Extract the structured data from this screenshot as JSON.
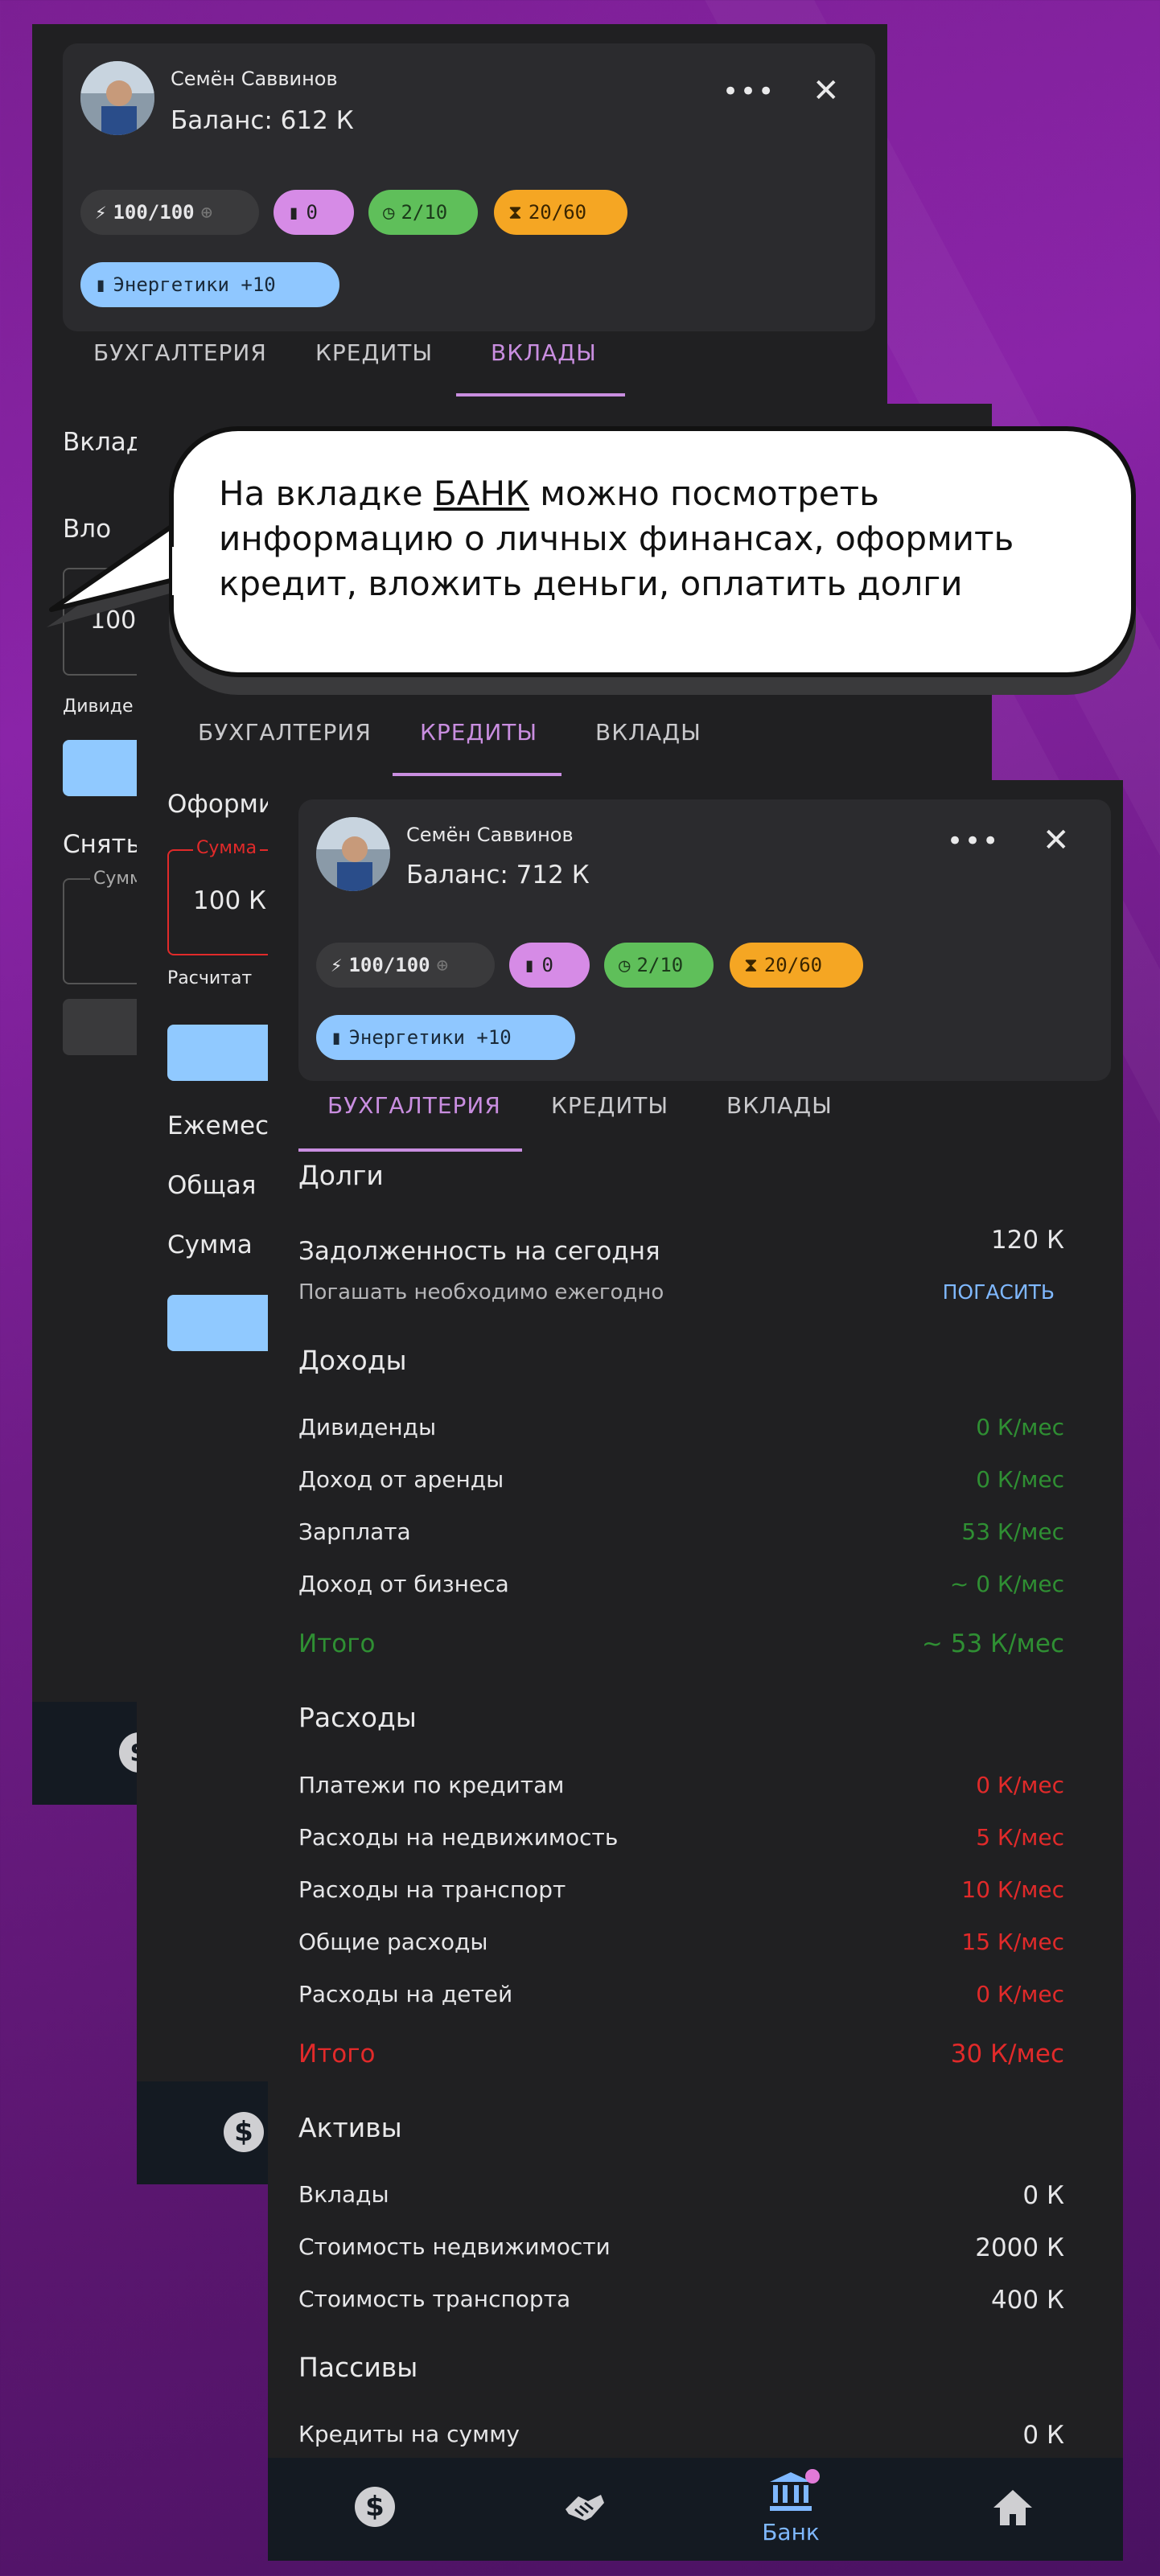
{
  "callout": {
    "line1_pre": "На вкладке ",
    "line1_link": "БАНК",
    "line1_post": " можно посмотреть",
    "line2": "информацию о личных финансах, оформить",
    "line3": "кредит, вложить деньги, оплатить долги"
  },
  "back_screen": {
    "profile": {
      "name": "Семён Саввинов",
      "balance": "Баланс: 612 К"
    },
    "chips": {
      "energy": "100/100",
      "battery": "0",
      "clock": "2/10",
      "hourglass": "20/60",
      "drinks": "Энергетики +10"
    },
    "tabs": [
      "БУХГАЛТЕРИЯ",
      "КРЕДИТЫ",
      "ВКЛАДЫ"
    ],
    "labels": [
      "Вклад",
      "Вло",
      "100",
      "Дивиде",
      "Снять",
      "Сумм"
    ]
  },
  "middle_screen": {
    "tabs": [
      "БУХГАЛТЕРИЯ",
      "КРЕДИТЫ",
      "ВКЛАДЫ"
    ],
    "labels": [
      "Оформи",
      "Сумма",
      "100 К",
      "Расчитат",
      "Ежемес",
      "Общая",
      "Сумма"
    ]
  },
  "front_screen": {
    "profile": {
      "name": "Семён Саввинов",
      "balance": "Баланс: 712 К"
    },
    "chips": {
      "energy": "100/100",
      "battery": "0",
      "clock": "2/10",
      "hourglass": "20/60",
      "drinks": "Энергетики +10"
    },
    "tabs": [
      "БУХГАЛТЕРИЯ",
      "КРЕДИТЫ",
      "ВКЛАДЫ"
    ],
    "active_tab": "БУХГАЛТЕРИЯ",
    "debts": {
      "title": "Долги",
      "today_label": "Задолженность на сегодня",
      "today_value": "120 К",
      "note": "Погашать необходимо ежегодно",
      "repay": "ПОГАСИТЬ"
    },
    "income": {
      "title": "Доходы",
      "rows": [
        {
          "label": "Дивиденды",
          "value": "0 К/мес"
        },
        {
          "label": "Доход от аренды",
          "value": "0 К/мес"
        },
        {
          "label": "Зарплата",
          "value": "53 К/мес"
        },
        {
          "label": "Доход от бизнеса",
          "value": "~ 0 К/мес"
        }
      ],
      "total_label": "Итого",
      "total_value": "~ 53 К/мес"
    },
    "expenses": {
      "title": "Расходы",
      "rows": [
        {
          "label": "Платежи по кредитам",
          "value": "0 К/мес"
        },
        {
          "label": "Расходы на недвижимость",
          "value": "5 К/мес"
        },
        {
          "label": "Расходы на транспорт",
          "value": "10 К/мес"
        },
        {
          "label": "Общие расходы",
          "value": "15 К/мес"
        },
        {
          "label": "Расходы на детей",
          "value": "0 К/мес"
        }
      ],
      "total_label": "Итого",
      "total_value": "30 К/мес"
    },
    "assets": {
      "title": "Активы",
      "rows": [
        {
          "label": "Вклады",
          "value": "0 К"
        },
        {
          "label": "Стоимость недвижимости",
          "value": "2000 К"
        },
        {
          "label": "Стоимость транспорта",
          "value": "400 К"
        }
      ]
    },
    "liabilities": {
      "title": "Пассивы",
      "rows": [
        {
          "label": "Кредиты на сумму",
          "value": "0 К"
        }
      ]
    },
    "nav": {
      "bank_label": "Банк"
    }
  },
  "colors": {
    "accent_purple": "#c98ee0",
    "income_green": "#2f8f33",
    "expense_red": "#e12a2a",
    "link_blue": "#7fb8ff",
    "chip_gray": "#3a3a3c",
    "chip_pink": "#d68be6",
    "chip_green": "#5fbf5a",
    "chip_orange": "#f5a623",
    "chip_blue": "#8fc7ff"
  }
}
